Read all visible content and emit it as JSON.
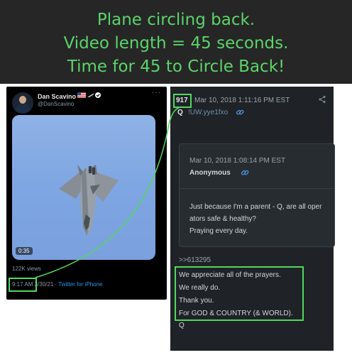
{
  "header": {
    "lines": [
      "Plane circling back.",
      "Video length = 45 seconds.",
      "Time for 45 to Circle Back!"
    ]
  },
  "tweet": {
    "name": "Dan Scavino",
    "handle": "@DanScavino",
    "more": "···",
    "duration": "0:35",
    "views": "122K views",
    "time": "9:17 AM",
    "date": "3/30/21",
    "separator": "·",
    "source": "Twitter for iPhone"
  },
  "post": {
    "number": "917",
    "date": "Mar 10, 2018 1:11:16 PM EST",
    "author": "Q",
    "tripcode": "!UW.yye1fxo",
    "quoted": {
      "date": "Mar 10, 2018 1:08:14 PM EST",
      "name": "Anonymous",
      "lines": [
        "Just because I'm a parent - Q, are all oper",
        "ators safe & healthy?",
        "Praying every day."
      ]
    },
    "reply_ref": ">>613295",
    "lines": [
      "We appreciate all of the prayers.",
      "We really do.",
      "Thank you.",
      "For GOD & COUNTRY (& WORLD)."
    ],
    "signature": "Q"
  },
  "colors": {
    "highlight": "#51d85c",
    "header_text": "#5bd46a",
    "tweet_bg": "#000000",
    "post_bg": "#1f2327",
    "link": "#1d9bf0"
  },
  "icons": [
    "share-icon",
    "link-icon",
    "verified-badge-icon",
    "us-flag-icon",
    "jet-icon"
  ]
}
